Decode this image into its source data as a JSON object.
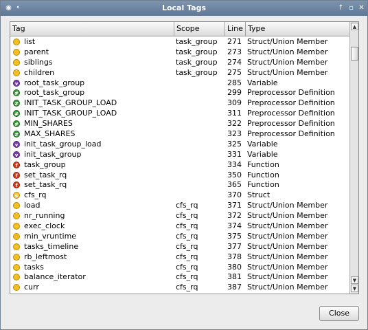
{
  "window": {
    "title": "Local Tags",
    "menu_glyph": "◉",
    "pin_glyph": "⚬",
    "help_glyph": "↑",
    "minimize_glyph": "▫",
    "close_glyph": "✕"
  },
  "table": {
    "columns": [
      "Tag",
      "Scope",
      "Line",
      "Type"
    ],
    "rows": [
      {
        "tag": "list",
        "scope": "task_group",
        "line": "271",
        "type": "Struct/Union Member",
        "icon": "member-icon"
      },
      {
        "tag": "parent",
        "scope": "task_group",
        "line": "273",
        "type": "Struct/Union Member",
        "icon": "member-icon"
      },
      {
        "tag": "siblings",
        "scope": "task_group",
        "line": "274",
        "type": "Struct/Union Member",
        "icon": "member-icon"
      },
      {
        "tag": "children",
        "scope": "task_group",
        "line": "275",
        "type": "Struct/Union Member",
        "icon": "member-icon"
      },
      {
        "tag": "root_task_group",
        "scope": "",
        "line": "285",
        "type": "Variable",
        "icon": "variable-icon"
      },
      {
        "tag": "root_task_group",
        "scope": "",
        "line": "299",
        "type": "Preprocessor Definition",
        "icon": "define-icon"
      },
      {
        "tag": "INIT_TASK_GROUP_LOAD",
        "scope": "",
        "line": "309",
        "type": "Preprocessor Definition",
        "icon": "define-icon"
      },
      {
        "tag": "INIT_TASK_GROUP_LOAD",
        "scope": "",
        "line": "311",
        "type": "Preprocessor Definition",
        "icon": "define-icon"
      },
      {
        "tag": "MIN_SHARES",
        "scope": "",
        "line": "322",
        "type": "Preprocessor Definition",
        "icon": "define-icon"
      },
      {
        "tag": "MAX_SHARES",
        "scope": "",
        "line": "323",
        "type": "Preprocessor Definition",
        "icon": "define-icon"
      },
      {
        "tag": "init_task_group_load",
        "scope": "",
        "line": "325",
        "type": "Variable",
        "icon": "variable-icon"
      },
      {
        "tag": "init_task_group",
        "scope": "",
        "line": "331",
        "type": "Variable",
        "icon": "variable-icon"
      },
      {
        "tag": "task_group",
        "scope": "",
        "line": "334",
        "type": "Function",
        "icon": "function-icon"
      },
      {
        "tag": "set_task_rq",
        "scope": "",
        "line": "350",
        "type": "Function",
        "icon": "function-icon"
      },
      {
        "tag": "set_task_rq",
        "scope": "",
        "line": "365",
        "type": "Function",
        "icon": "function-icon"
      },
      {
        "tag": "cfs_rq",
        "scope": "",
        "line": "370",
        "type": "Struct",
        "icon": "struct-icon"
      },
      {
        "tag": "load",
        "scope": "cfs_rq",
        "line": "371",
        "type": "Struct/Union Member",
        "icon": "member-icon"
      },
      {
        "tag": "nr_running",
        "scope": "cfs_rq",
        "line": "372",
        "type": "Struct/Union Member",
        "icon": "member-icon"
      },
      {
        "tag": "exec_clock",
        "scope": "cfs_rq",
        "line": "374",
        "type": "Struct/Union Member",
        "icon": "member-icon"
      },
      {
        "tag": "min_vruntime",
        "scope": "cfs_rq",
        "line": "375",
        "type": "Struct/Union Member",
        "icon": "member-icon"
      },
      {
        "tag": "tasks_timeline",
        "scope": "cfs_rq",
        "line": "377",
        "type": "Struct/Union Member",
        "icon": "member-icon"
      },
      {
        "tag": "rb_leftmost",
        "scope": "cfs_rq",
        "line": "378",
        "type": "Struct/Union Member",
        "icon": "member-icon"
      },
      {
        "tag": "tasks",
        "scope": "cfs_rq",
        "line": "380",
        "type": "Struct/Union Member",
        "icon": "member-icon"
      },
      {
        "tag": "balance_iterator",
        "scope": "cfs_rq",
        "line": "381",
        "type": "Struct/Union Member",
        "icon": "member-icon"
      },
      {
        "tag": "curr",
        "scope": "cfs_rq",
        "line": "387",
        "type": "Struct/Union Member",
        "icon": "member-icon"
      }
    ]
  },
  "icon_styles": {
    "member-icon": {
      "bg": "#f2c023",
      "border": "#b88a00",
      "glyph": ""
    },
    "variable-icon": {
      "bg": "#7a3fa8",
      "border": "#4d1f70",
      "glyph": "v"
    },
    "define-icon": {
      "bg": "#3e9a3e",
      "border": "#1f661f",
      "glyph": "#"
    },
    "function-icon": {
      "bg": "#d43b1e",
      "border": "#8c1f0c",
      "glyph": "f"
    },
    "struct-icon": {
      "bg": "#f5c842",
      "border": "#b88a00",
      "glyph": "s"
    }
  },
  "scrollbar": {
    "up_glyph": "▲",
    "down_glyph": "▼"
  },
  "buttons": {
    "close_label": "Close"
  }
}
